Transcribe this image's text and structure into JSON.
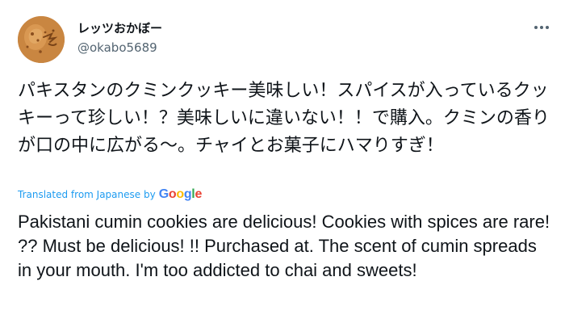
{
  "author": {
    "display_name": "レッツおかぼー",
    "handle": "@okabo5689",
    "avatar_icon": "cookie-avatar-icon"
  },
  "menu": {
    "more_icon": "more-icon"
  },
  "tweet": {
    "text": "パキスタンのクミンクッキー美味しい！スパイスが入っているクッキーって珍しい！？美味しいに違いない！！で購入。クミンの香りが口の中に広がる〜。チャイとお菓子にハマりすぎ！"
  },
  "translation": {
    "label": "Translated from Japanese by",
    "provider_letters": [
      "G",
      "o",
      "o",
      "g",
      "l",
      "e"
    ],
    "provider_colors": [
      "#4285F4",
      "#EA4335",
      "#FBBC05",
      "#4285F4",
      "#34A853",
      "#EA4335"
    ],
    "text": "Pakistani cumin cookies are delicious! Cookies with spices are rare! ?? Must be delicious! !! Purchased at. The scent of cumin spreads in your mouth. I'm too addicted to chai and sweets!"
  },
  "colors": {
    "link": "#1d9bf0",
    "secondary_text": "#536471",
    "primary_text": "#0f1419"
  }
}
